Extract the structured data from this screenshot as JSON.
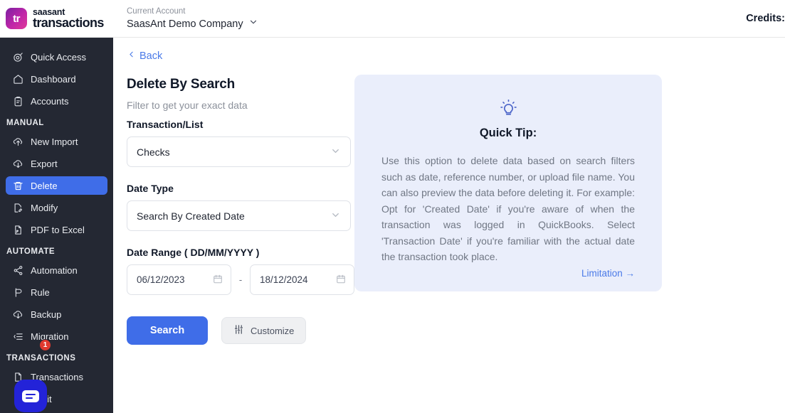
{
  "header": {
    "logo_top": "saasant",
    "logo_bottom": "transactions",
    "logo_mark": "tr",
    "account_label": "Current Account",
    "account_name": "SaasAnt Demo Company",
    "credits_label": "Credits:"
  },
  "sidebar": {
    "top_items": [
      {
        "label": "Quick Access",
        "icon": "target-icon"
      },
      {
        "label": "Dashboard",
        "icon": "home-icon"
      },
      {
        "label": "Accounts",
        "icon": "clipboard-icon"
      }
    ],
    "manual_section": "MANUAL",
    "manual_items": [
      {
        "label": "New Import",
        "icon": "upload-cloud-icon",
        "active": false
      },
      {
        "label": "Export",
        "icon": "download-cloud-icon",
        "active": false
      },
      {
        "label": "Delete",
        "icon": "trash-icon",
        "active": true
      },
      {
        "label": "Modify",
        "icon": "file-edit-icon",
        "active": false
      },
      {
        "label": "PDF to Excel",
        "icon": "file-pdf-icon",
        "active": false
      }
    ],
    "automate_section": "AUTOMATE",
    "automate_items": [
      {
        "label": "Automation",
        "icon": "share-nodes-icon"
      },
      {
        "label": "Rule",
        "icon": "megaphone-icon"
      },
      {
        "label": "Backup",
        "icon": "download-cloud-icon"
      },
      {
        "label": "Migration",
        "icon": "list-indent-icon"
      }
    ],
    "transactions_section": "TRANSACTIONS",
    "transactions_items": [
      {
        "label": "Transactions",
        "icon": "file-icon",
        "badge": "1"
      },
      {
        "label": "Audit",
        "icon": "file-icon"
      }
    ],
    "chat_icon": "chat-bubble-icon"
  },
  "main": {
    "back_label": "Back",
    "title": "Delete By Search",
    "subtitle": "Filter to get your exact data",
    "transaction_list": {
      "label": "Transaction/List",
      "value": "Checks"
    },
    "date_type": {
      "label": "Date Type",
      "value": "Search By Created Date"
    },
    "date_range": {
      "label": "Date Range ( DD/MM/YYYY )",
      "from": "06/12/2023",
      "to": "18/12/2024",
      "separator": "-"
    },
    "search_button": "Search",
    "customize_button": "Customize"
  },
  "tip": {
    "icon": "lightbulb-icon",
    "title": "Quick Tip:",
    "body": "Use this option to delete data based on search filters such as date, reference number, or upload file name. You can also preview the data before deleting it. For example: Opt for 'Created Date' if you're aware of when the transaction was logged in QuickBooks. Select 'Transaction Date' if you're familiar with the actual date the transaction took place.",
    "link": "Limitation →"
  },
  "colors": {
    "accent_blue": "#3f6de8",
    "sidebar_bg": "#242833",
    "tip_bg": "#eaeefb",
    "badge_red": "#e03a2f"
  }
}
